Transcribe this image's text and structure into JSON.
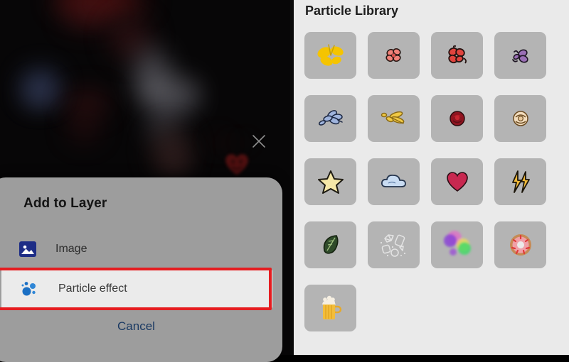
{
  "canvas": {
    "name": "photo-canvas",
    "close_icon": "close-x-icon",
    "sticker_icon": "heart-sticker"
  },
  "add_layer_sheet": {
    "title": "Add to Layer",
    "options": [
      {
        "icon": "image-icon",
        "label": "Image",
        "selected": false
      },
      {
        "icon": "particle-effect-icon",
        "label": "Particle effect",
        "selected": true
      }
    ],
    "cancel_label": "Cancel",
    "selection_color": "#e51d20",
    "sheet_color": "#9d9d9d",
    "cancel_color": "#1b3a63"
  },
  "library": {
    "title": "Particle Library",
    "background": "#eaeaea",
    "tile_color": "#b4b4b4",
    "columns": 4,
    "items": [
      {
        "name": "yellow-butterfly",
        "icon": "butterfly"
      },
      {
        "name": "pink-blossom",
        "icon": "blossom-pink"
      },
      {
        "name": "red-blossom",
        "icon": "blossom-red"
      },
      {
        "name": "purple-bee",
        "icon": "bee-purple"
      },
      {
        "name": "blue-petals",
        "icon": "petals-blue"
      },
      {
        "name": "gold-dragonfly",
        "icon": "dragonfly-gold"
      },
      {
        "name": "red-rose",
        "icon": "rose-red"
      },
      {
        "name": "cream-rose",
        "icon": "rose-cream"
      },
      {
        "name": "gold-star",
        "icon": "star-gold"
      },
      {
        "name": "blue-cloud",
        "icon": "cloud-blue"
      },
      {
        "name": "pink-heart",
        "icon": "heart-pink"
      },
      {
        "name": "gold-lightning",
        "icon": "lightning-gold"
      },
      {
        "name": "green-leaf",
        "icon": "leaf-green"
      },
      {
        "name": "white-gems",
        "icon": "gems-white"
      },
      {
        "name": "color-splash",
        "icon": "splash-color"
      },
      {
        "name": "pink-donut",
        "icon": "donut"
      },
      {
        "name": "beer-mug",
        "icon": "beer-mug"
      }
    ]
  }
}
